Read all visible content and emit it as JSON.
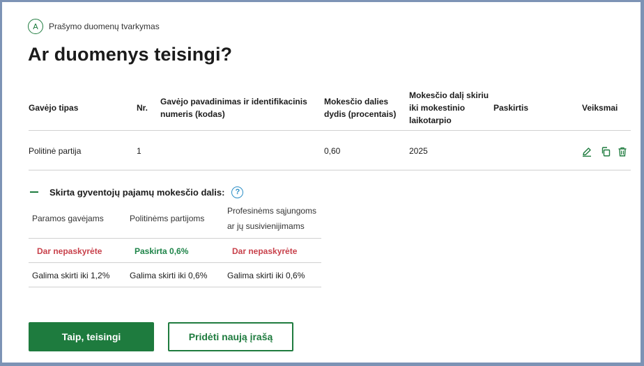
{
  "step": {
    "letter": "A",
    "label": "Prašymo duomenų tvarkymas"
  },
  "page_title": "Ar duomenys teisingi?",
  "table": {
    "headers": {
      "recipient_type": "Gavėjo tipas",
      "nr": "Nr.",
      "recipient_name": "Gavėjo pavadinimas ir identifikacinis numeris (kodas)",
      "tax_share": "Mokesčio dalies dydis (procentais)",
      "assigned_until": "Mokesčio dalį skiriu iki mokestinio laikotarpio",
      "purpose": "Paskirtis",
      "actions": "Veiksmai"
    },
    "rows": [
      {
        "recipient_type": "Politinė partija",
        "nr": "1",
        "recipient_name": "",
        "tax_share": "0,60",
        "assigned_until": "2025",
        "purpose": ""
      }
    ]
  },
  "allocation": {
    "title": "Skirta gyventojų pajamų mokesčio dalis:",
    "help_icon": "?",
    "columns": [
      {
        "header": "Paramos gavėjams",
        "status": "Dar nepaskyrėte",
        "status_color": "#c8414b",
        "limit": "Galima skirti iki 1,2%"
      },
      {
        "header": "Politinėms partijoms",
        "status": "Paskirta 0,6%",
        "status_color": "#1e8449",
        "limit": "Galima skirti iki 0,6%"
      },
      {
        "header": "Profesinėms sąjungoms ar jų susivienijimams",
        "status": "Dar nepaskyrėte",
        "status_color": "#c8414b",
        "limit": "Galima skirti iki 0,6%"
      }
    ]
  },
  "buttons": {
    "confirm": "Taip, teisingi",
    "add_new": "Pridėti naują įrašą"
  },
  "colors": {
    "primary": "#1e7b3e",
    "frame": "#7d93b5",
    "help": "#2b8ec6",
    "danger": "#c8414b"
  },
  "icons": {
    "edit": "pencil-icon",
    "copy": "copy-icon",
    "delete": "trash-icon",
    "help": "question-icon",
    "collapse": "minus-icon"
  }
}
